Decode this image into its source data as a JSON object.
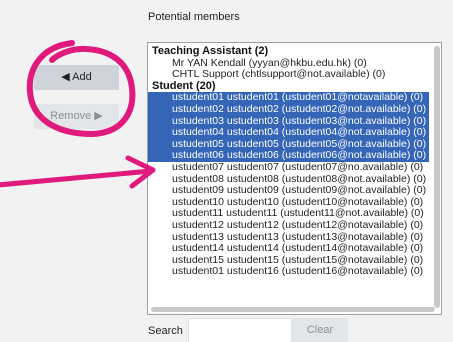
{
  "buttons": {
    "add": "◀ Add",
    "remove": "Remove ▶"
  },
  "members": {
    "label": "Potential members",
    "groups": [
      {
        "title": "Teaching Assistant (2)",
        "options": [
          {
            "text": "Mr YAN Kendall (yyyan@hkbu.edu.hk) (0)",
            "selected": false
          },
          {
            "text": "CHTL Support (chtlsupport@not.available) (0)",
            "selected": false
          }
        ]
      },
      {
        "title": "Student (20)",
        "options": [
          {
            "text": "ustudent01 ustudent01 (ustudent01@notavailable) (0)",
            "selected": true
          },
          {
            "text": "ustudent02 ustudent02 (ustudent02@not.available) (0)",
            "selected": true
          },
          {
            "text": "ustudent03 ustudent03 (ustudent03@not.available) (0)",
            "selected": true
          },
          {
            "text": "ustudent04 ustudent04 (ustudent04@not.available) (0)",
            "selected": true
          },
          {
            "text": "ustudent05 ustudent05 (ustudent05@not.available) (0)",
            "selected": true
          },
          {
            "text": "ustudent06 ustudent06 (ustudent06@not.available) (0)",
            "selected": true
          },
          {
            "text": "ustudent07 ustudent07 (ustudent07@no.available) (0)",
            "selected": false
          },
          {
            "text": "ustudent08 ustudent08 (ustudent08@not.available) (0)",
            "selected": false
          },
          {
            "text": "ustudent09 ustudent09 (ustudent09@not.available) (0)",
            "selected": false
          },
          {
            "text": "ustudent10 ustudent10 (ustudent10@notavailable) (0)",
            "selected": false
          },
          {
            "text": "ustudent11 ustudent11 (ustudent11@not.available) (0)",
            "selected": false
          },
          {
            "text": "ustudent12 ustudent12 (ustudent12@notavailable) (0)",
            "selected": false
          },
          {
            "text": "ustudent13 ustudent13 (ustudent13@notavailable) (0)",
            "selected": false
          },
          {
            "text": "ustudent14 ustudent14 (ustudent14@notavailable) (0)",
            "selected": false
          },
          {
            "text": "ustudent15 ustudent15 (ustudent15@notavailable) (0)",
            "selected": false
          },
          {
            "text": "ustudent01 ustudent16 (ustudent16@notavailable) (0)",
            "selected": false
          }
        ]
      }
    ]
  },
  "search": {
    "label": "Search",
    "value": "",
    "clear_label": "Clear"
  },
  "colors": {
    "selection": "#3465b6",
    "annotation": "#e0197d"
  }
}
